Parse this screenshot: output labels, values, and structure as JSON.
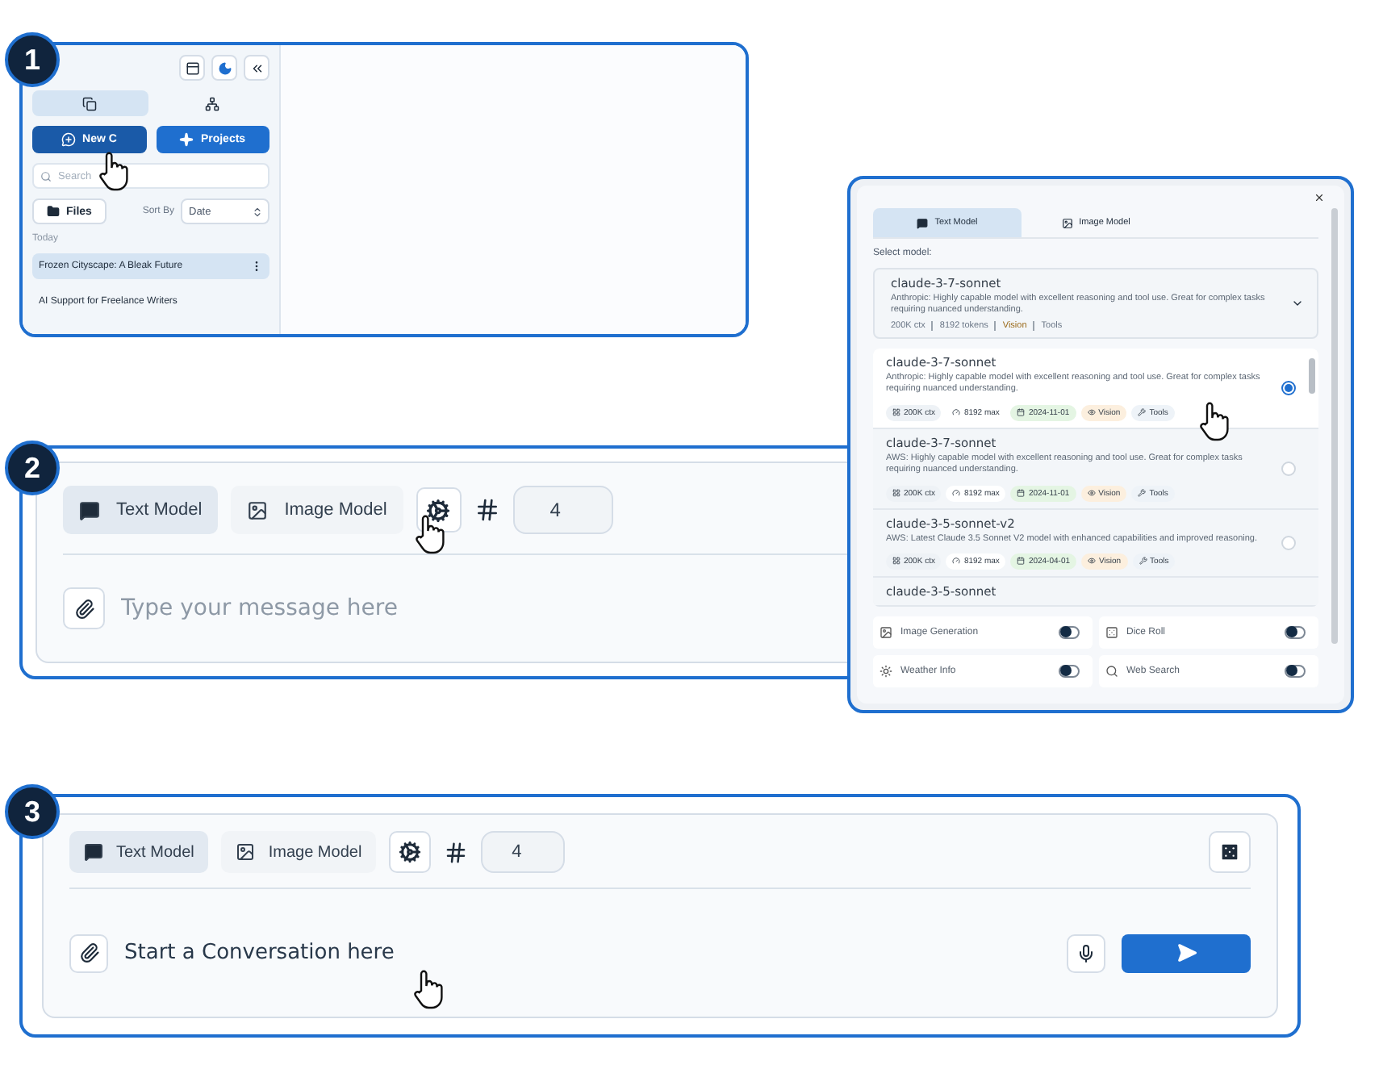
{
  "step1": {
    "badge": "1",
    "sidebar": {
      "view_tabs": [
        {
          "kind": "chats",
          "selected": true
        },
        {
          "kind": "projects",
          "selected": false
        }
      ],
      "new_chat": "New C",
      "projects": "Projects",
      "search": {
        "placeholder": "Search"
      },
      "files": "Files",
      "sort_label": "Sort By",
      "sort_value": "Date",
      "section": "Today",
      "chats": [
        {
          "title": "Frozen Cityscape: A Bleak Future",
          "selected": true
        },
        {
          "title": "AI Support for Freelance Writers",
          "selected": false
        }
      ]
    }
  },
  "step2": {
    "badge": "2",
    "tabs": [
      {
        "label": "Text Model",
        "kind": "text",
        "selected": true
      },
      {
        "label": "Image Model",
        "kind": "image",
        "selected": false
      }
    ],
    "count": "4",
    "message": {
      "placeholder": "Type your message here"
    }
  },
  "model_picker": {
    "tabs": [
      {
        "label": "Text Model",
        "kind": "text",
        "selected": true
      },
      {
        "label": "Image Model",
        "kind": "image",
        "selected": false
      }
    ],
    "select_label": "Select model:",
    "current": {
      "name": "claude-3-7-sonnet",
      "description": "Anthropic: Highly capable model with excellent reasoning and tool use. Great for complex tasks requiring nuanced understanding.",
      "meta": [
        {
          "text": "200K ctx",
          "kind": "plain"
        },
        {
          "text": "8192 tokens",
          "kind": "plain"
        },
        {
          "text": "Vision",
          "kind": "vision"
        },
        {
          "text": "Tools",
          "kind": "plain"
        }
      ]
    },
    "models": [
      {
        "name": "claude-3-7-sonnet",
        "description": "Anthropic: Highly capable model with excellent reasoning and tool use. Great for complex tasks requiring nuanced understanding.",
        "selected": true,
        "tags": [
          {
            "text": "200K ctx",
            "kind": "ctx"
          },
          {
            "text": "8192 max",
            "kind": "max"
          },
          {
            "text": "2024-11-01",
            "kind": "date"
          },
          {
            "text": "Vision",
            "kind": "vision"
          },
          {
            "text": "Tools",
            "kind": "tools"
          }
        ]
      },
      {
        "name": "claude-3-7-sonnet",
        "description": "AWS: Highly capable model with excellent reasoning and tool use. Great for complex tasks requiring nuanced understanding.",
        "selected": false,
        "tags": [
          {
            "text": "200K ctx",
            "kind": "ctx"
          },
          {
            "text": "8192 max",
            "kind": "max"
          },
          {
            "text": "2024-11-01",
            "kind": "date"
          },
          {
            "text": "Vision",
            "kind": "vision"
          },
          {
            "text": "Tools",
            "kind": "tools"
          }
        ]
      },
      {
        "name": "claude-3-5-sonnet-v2",
        "description": "AWS: Latest Claude 3.5 Sonnet V2 model with enhanced capabilities and improved reasoning.",
        "selected": false,
        "tags": [
          {
            "text": "200K ctx",
            "kind": "ctx"
          },
          {
            "text": "8192 max",
            "kind": "max"
          },
          {
            "text": "2024-04-01",
            "kind": "date"
          },
          {
            "text": "Vision",
            "kind": "vision"
          },
          {
            "text": "Tools",
            "kind": "tools"
          }
        ]
      },
      {
        "name": "claude-3-5-sonnet",
        "selected": false
      }
    ],
    "tools": [
      {
        "label": "Image Generation",
        "kind": "image",
        "on": false
      },
      {
        "label": "Dice Roll",
        "kind": "dice",
        "on": false
      },
      {
        "label": "Weather Info",
        "kind": "weather",
        "on": false
      },
      {
        "label": "Web Search",
        "kind": "search",
        "on": false
      }
    ]
  },
  "step3": {
    "badge": "3",
    "tabs": [
      {
        "label": "Text Model",
        "kind": "text",
        "selected": true
      },
      {
        "label": "Image Model",
        "kind": "image",
        "selected": false
      }
    ],
    "count": "4",
    "message": {
      "value": "Start a Conversation here"
    }
  }
}
